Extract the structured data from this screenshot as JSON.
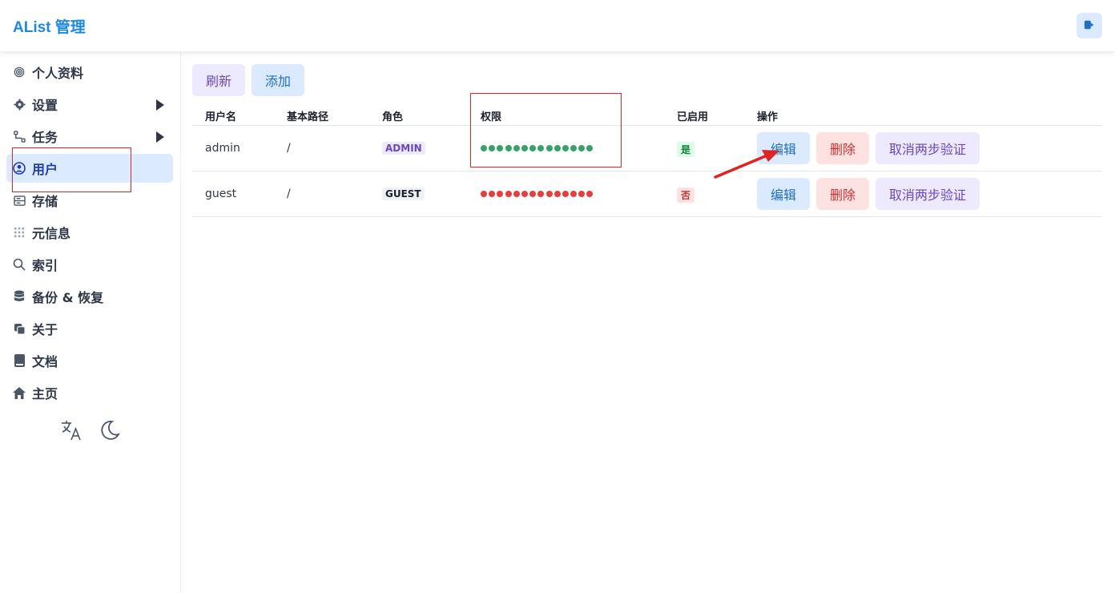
{
  "header": {
    "title": "AList 管理"
  },
  "sidebar": {
    "items": [
      {
        "label": "个人资料",
        "icon": "fingerprint-icon"
      },
      {
        "label": "设置",
        "icon": "gear-icon",
        "expandable": true
      },
      {
        "label": "任务",
        "icon": "flow-icon",
        "expandable": true
      },
      {
        "label": "用户",
        "icon": "user-circle-icon",
        "active": true
      },
      {
        "label": "存储",
        "icon": "storage-icon"
      },
      {
        "label": "元信息",
        "icon": "grid-icon"
      },
      {
        "label": "索引",
        "icon": "search-icon"
      },
      {
        "label": "备份 & 恢复",
        "icon": "database-icon"
      },
      {
        "label": "关于",
        "icon": "copy-icon"
      },
      {
        "label": "文档",
        "icon": "book-icon"
      },
      {
        "label": "主页",
        "icon": "home-icon"
      }
    ]
  },
  "toolbar": {
    "refresh_label": "刷新",
    "add_label": "添加"
  },
  "table": {
    "headers": [
      "用户名",
      "基本路径",
      "角色",
      "权限",
      "已启用",
      "操作"
    ],
    "rows": [
      {
        "username": "admin",
        "base_path": "/",
        "role": "ADMIN",
        "permissions_granted": 14,
        "permissions_total": 14,
        "enabled": "是",
        "actions": {
          "edit": "编辑",
          "delete": "删除",
          "cancel_2fa": "取消两步验证"
        }
      },
      {
        "username": "guest",
        "base_path": "/",
        "role": "GUEST",
        "permissions_granted": 0,
        "permissions_total": 14,
        "enabled": "否",
        "actions": {
          "edit": "编辑",
          "delete": "删除",
          "cancel_2fa": "取消两步验证"
        }
      }
    ]
  },
  "colors": {
    "accent": "#1e88e5",
    "permission_on": "#38a169",
    "permission_off": "#e53e3e",
    "annotation": "#e02424"
  }
}
